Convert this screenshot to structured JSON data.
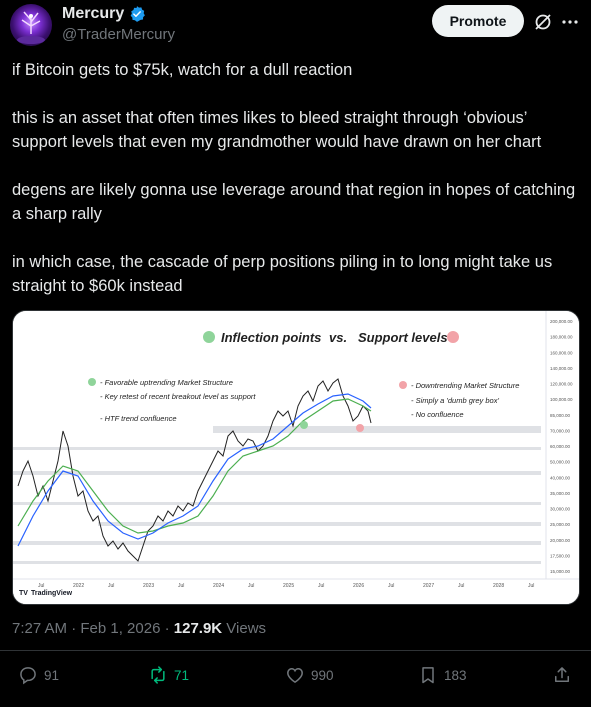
{
  "author": {
    "name": "Mercury",
    "handle": "@TraderMercury",
    "verified_icon": "verified-badge-icon"
  },
  "header": {
    "promote_label": "Promote"
  },
  "tweet": {
    "paragraphs": [
      "if Bitcoin gets to $75k, watch for a dull reaction",
      "this is an asset that often times likes to bleed straight through ‘obvious’ support levels that even my grandmother would have drawn on her chart",
      "degens are likely gonna use leverage around that region in hopes of catching a sharp rally",
      "in which case, the cascade of perp positions piling in to long might take us straight to $60k instead"
    ]
  },
  "chart_image": {
    "heading_left": "Inflection points",
    "heading_vs": "vs.",
    "heading_right": "Support levels",
    "left_notes": [
      "- Favorable uptrending Market Structure",
      "- Key retest of recent breakout level as support",
      "- HTF trend confluence"
    ],
    "right_notes": [
      "- Downtrending Market Structure",
      "- Simply a 'dumb grey box'",
      "- No confluence"
    ],
    "x_ticks": [
      "Jul",
      "2022",
      "Jul",
      "2023",
      "Jul",
      "2024",
      "Jul",
      "2025",
      "Jul",
      "2026",
      "Jul",
      "2027",
      "Jul",
      "2028",
      "Jul"
    ],
    "y_ticks": [
      "200,000.00",
      "180,000.00",
      "160,000.00",
      "140,000.00",
      "120,000.00",
      "100,000.00",
      "85,000.00",
      "70,000.00",
      "60,000.00",
      "50,000.00",
      "40,000.00",
      "35,000.00",
      "30,000.00",
      "25,000.00",
      "20,000.00",
      "17,500.00",
      "15,000.00"
    ],
    "watermark": "TradingView",
    "colors": {
      "green": "#8fd49a",
      "red": "#f2a3a8",
      "blue": "#2962ff",
      "ma_green": "#4caf50"
    }
  },
  "meta": {
    "time": "7:27 AM · Feb 1, 2026 · ",
    "views_count": "127.9K",
    "views_label": " Views"
  },
  "actions": {
    "replies": "91",
    "reposts": "71",
    "likes": "990",
    "bookmarks": "183"
  }
}
